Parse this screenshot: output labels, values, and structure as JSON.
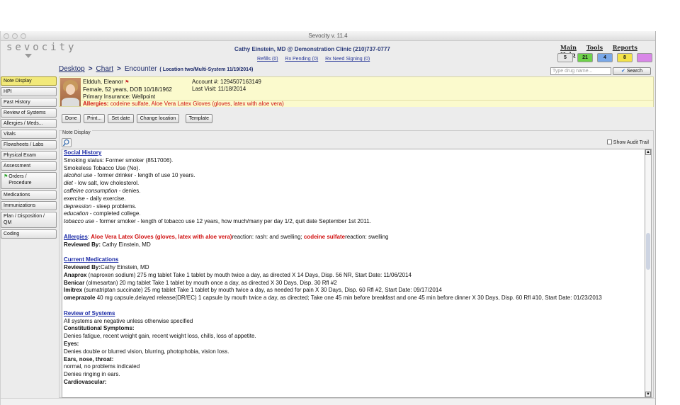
{
  "window": {
    "title": "Sevocity v. 11.4"
  },
  "header": {
    "logo": "sevocity",
    "user_clinic": "Cathy Einstein, MD @ Demonstration Clinic (210)737-0777",
    "rx_links": [
      "Refills (0)",
      "Rx Pending (0)",
      "Rx Need Signing (0)"
    ],
    "menu": [
      "Main",
      "Tools",
      "Reports",
      "Help"
    ],
    "badges": [
      {
        "value": "5",
        "color": "#e6e6e6"
      },
      {
        "value": "21",
        "color": "#6fd24b"
      },
      {
        "value": "4",
        "color": "#7aa8e8"
      },
      {
        "value": "8",
        "color": "#f3e34a"
      },
      {
        "value": "",
        "color": "#d987e8"
      }
    ]
  },
  "breadcrumb": {
    "items": [
      "Desktop",
      "Chart",
      "Encounter"
    ],
    "sep": ">",
    "location": "( Location two/Multi-System 11/19/2014)"
  },
  "search": {
    "placeholder": "Type drug name...",
    "button": "Search"
  },
  "sidebar": {
    "items": [
      "Note Display",
      "HPI",
      "Past History",
      "Review of Systems",
      "Allergies / Meds...",
      "Vitals",
      "Flowsheets / Labs",
      "Physical Exam",
      "Assessment",
      "Orders / Procedure",
      "Medications",
      "Immunizations",
      "Plan / Disposition / QM",
      "Coding"
    ]
  },
  "patient": {
    "name": "Eldduh, Eleanor",
    "demo": "Female, 52 years, DOB 10/18/1962",
    "insurance": "Primary Insurance: Wellpoint",
    "account": "Account #: 1294507163149",
    "last_visit": "Last Visit: 11/18/2014",
    "allergies_label": "Allergies:",
    "allergies": "codeine sulfate, Aloe Vera Latex Gloves (gloves, latex with aloe vera)"
  },
  "toolbar": {
    "buttons": [
      "Done",
      "Print...",
      "Set date",
      "Change location",
      "Template"
    ]
  },
  "note_display": {
    "label": "Note Display",
    "audit_label": "Show Audit Trail",
    "social_history": {
      "title": "Social History",
      "lines": [
        "Smoking status: Former smoker (8517006).",
        "Smokeless Tobacco Use (No)."
      ],
      "items": [
        {
          "label": "alcohol use",
          "text": " - former drinker - length of use 10 years."
        },
        {
          "label": "diet",
          "text": " - low salt, low cholesterol."
        },
        {
          "label": "caffeine consumption",
          "text": " - denies."
        },
        {
          "label": "exercise",
          "text": " - daily exercise."
        },
        {
          "label": "depression",
          "text": " - sleep problems."
        },
        {
          "label": "education",
          "text": " - completed college."
        },
        {
          "label": "tobacco use",
          "text": " - former smoker - length of tobacco use 12 years, how much/many per day 1/2, quit date September 1st 2011."
        }
      ]
    },
    "allergies": {
      "title": "Allergies",
      "a1": "Aloe Vera Latex Gloves (gloves, latex with aloe vera)",
      "r1": "reaction: rash: and swelling;",
      "a2": "codeine sulfate",
      "r2": "reaction: swelling",
      "reviewed_label": "Reviewed By:",
      "reviewed_by": "Cathy Einstein, MD"
    },
    "current_medications": {
      "title": "Current Medications",
      "reviewed_label": "Reviewed By:",
      "reviewed_by": "Cathy Einstein, MD",
      "meds": [
        {
          "name": "Anaprox",
          "text": " (naproxen sodium) 275 mg tablet Take 1 tablet by mouth twice a day, as directed X 14 Days, Disp. 56 NR, Start Date: 11/06/2014"
        },
        {
          "name": "Benicar",
          "text": " (olmesartan) 20 mg tablet Take 1 tablet by mouth once a day, as directed X 30 Days, Disp. 30 Rfl #2"
        },
        {
          "name": "Imitrex",
          "text": " (sumatriptan succinate) 25 mg tablet Take 1 tablet by mouth twice a day, as needed for pain X 30 Days, Disp. 60 Rfl #2, Start Date: 09/17/2014"
        },
        {
          "name": "omeprazole",
          "text": " 40 mg capsule,delayed release(DR/EC) 1 capsule by mouth twice a day, as directed; Take one 45 min before breakfast and one 45 min before dinner X 30 Days, Disp. 60 Rfl #10, Start Date: 01/23/2013"
        }
      ]
    },
    "review_of_systems": {
      "title": "Review of Systems",
      "intro": "All systems are negative unless otherwise specified",
      "constitutional_label": "Constitutional Symptoms:",
      "constitutional": "Denies fatigue, recent weight gain, recent weight loss, chills, loss of appetite.",
      "eyes_label": "Eyes:",
      "eyes": "Denies double or blurred vision, blurring, photophobia, vision loss.",
      "ent_label": "Ears, nose, throat:",
      "ent_1": "normal, no problems indicated",
      "ent_2": "Denies ringing in ears.",
      "cardio_label": "Cardiovascular:"
    }
  }
}
